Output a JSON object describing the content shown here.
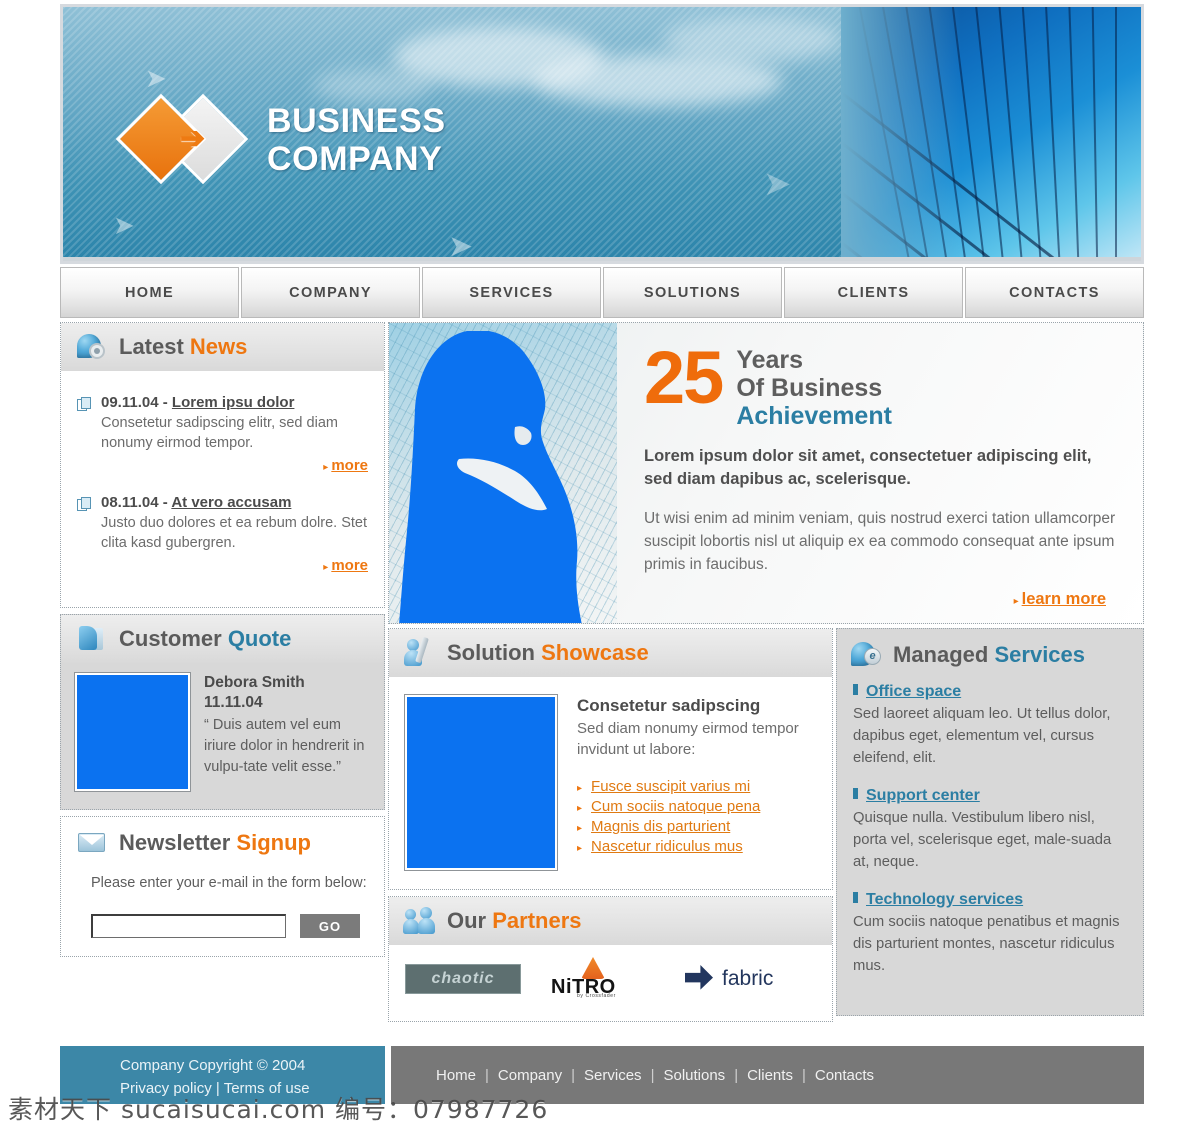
{
  "brand": {
    "line1": "BUSINESS",
    "line2": "COMPANY",
    "accent_orange": "#ee7711",
    "accent_blue": "#2b7ea3"
  },
  "nav": {
    "items": [
      {
        "label": "HOME"
      },
      {
        "label": "COMPANY"
      },
      {
        "label": "SERVICES"
      },
      {
        "label": "SOLUTIONS"
      },
      {
        "label": "CLIENTS"
      },
      {
        "label": "CONTACTS"
      }
    ]
  },
  "news": {
    "title_main": "Latest",
    "title_accent": "News",
    "items": [
      {
        "date": "09.11.04 - ",
        "link": "Lorem ipsu dolor",
        "text": "Consetetur sadipscing elitr, sed diam nonumy eirmod tempor.",
        "more": "more"
      },
      {
        "date": "08.11.04 - ",
        "link": "At vero accusam",
        "text": "Justo duo dolores et ea rebum dolre. Stet clita kasd gubergren.",
        "more": "more"
      }
    ]
  },
  "hero": {
    "number": "25",
    "line1": "Years",
    "line2": "Of Business",
    "line3": "Achievement",
    "lead": "Lorem ipsum dolor sit amet, consectetuer adipiscing elit, sed diam dapibus ac, scelerisque.",
    "body": "Ut wisi enim ad minim veniam, quis nostrud exerci tation ullamcorper suscipit lobortis nisl ut aliquip ex ea commodo consequat ante ipsum primis in faucibus.",
    "more": "learn more"
  },
  "quote": {
    "title_main": "Customer",
    "title_accent": "Quote",
    "name": "Debora Smith",
    "date": "11.11.04",
    "text": "“ Duis autem vel eum iriure dolor in hendrerit in vulpu-tate velit esse.”"
  },
  "newsletter": {
    "title_main": "Newsletter",
    "title_accent": "Signup",
    "instruction": "Please enter your e-mail in the form below:",
    "input_value": "",
    "input_placeholder": "",
    "button_label": "GO"
  },
  "showcase": {
    "title_main": "Solution",
    "title_accent": "Showcase",
    "headline": "Consetetur sadipscing",
    "sub": "Sed diam nonumy eirmod tempor invidunt ut labore:",
    "links": [
      "Fusce suscipit varius mi",
      "Cum sociis natoque pena",
      "Magnis dis parturient",
      "Nascetur ridiculus mus"
    ]
  },
  "partners": {
    "title_main": "Our",
    "title_accent": "Partners",
    "logos": [
      {
        "name": "chaotic",
        "label": "chaotic"
      },
      {
        "name": "nitro",
        "label": "NiTRO",
        "sub": "by Crossfader"
      },
      {
        "name": "fabric",
        "label": "fabric"
      }
    ]
  },
  "managed": {
    "title_main": "Managed",
    "title_accent": "Services",
    "services": [
      {
        "title": "Office space",
        "text": "Sed laoreet aliquam leo. Ut tellus dolor, dapibus eget, elementum vel, cursus eleifend, elit."
      },
      {
        "title": "Support center",
        "text": "Quisque nulla. Vestibulum libero nisl, porta vel, scelerisque eget, male-suada at, neque."
      },
      {
        "title": "Technology services",
        "text": "Cum sociis natoque penatibus et magnis dis parturient montes, nascetur ridiculus mus."
      }
    ]
  },
  "footer": {
    "copyright": "Company Copyright © 2004",
    "privacy": "Privacy policy",
    "separator": "|",
    "terms": "Terms of use",
    "links": [
      "Home",
      "Company",
      "Services",
      "Solutions",
      "Clients",
      "Contacts"
    ]
  },
  "watermark": {
    "text": "素材天下 sucaisucai.com 编号：07987726"
  }
}
